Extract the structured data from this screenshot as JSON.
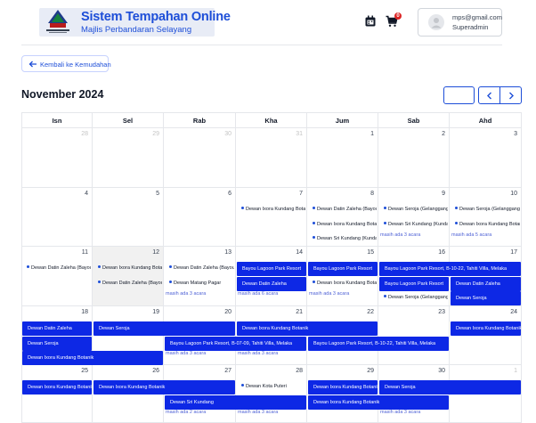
{
  "header": {
    "title": "Sistem Tempahan Online",
    "subtitle": "Majlis Perbandaran Selayang",
    "logo_caption": "Majlis Perbandaran Selayang",
    "cart_count": "0",
    "user_email": "mps@gmail.com",
    "user_role": "Superadmin"
  },
  "nav": {
    "back_label": "Kembali ke Kemudahan"
  },
  "calendar": {
    "month_label": "November 2024",
    "weekdays": [
      "Isn",
      "Sel",
      "Rab",
      "Kha",
      "Jum",
      "Sab",
      "Ahd"
    ],
    "weeks": [
      {
        "days": [
          "28",
          "29",
          "30",
          "31",
          "1",
          "2",
          "3"
        ],
        "other": [
          0,
          1,
          2,
          3
        ]
      },
      {
        "days": [
          "4",
          "5",
          "6",
          "7",
          "8",
          "9",
          "10"
        ],
        "other": []
      },
      {
        "days": [
          "11",
          "12",
          "13",
          "14",
          "15",
          "16",
          "17"
        ],
        "other": []
      },
      {
        "days": [
          "18",
          "19",
          "20",
          "21",
          "22",
          "23",
          "24"
        ],
        "other": []
      },
      {
        "days": [
          "25",
          "26",
          "27",
          "28",
          "29",
          "30",
          "1"
        ],
        "other": [
          6
        ]
      }
    ],
    "today": {
      "week": 2,
      "day": 1
    },
    "dot_events": [
      {
        "w": 1,
        "d": 3,
        "row": 0,
        "label": "Dewan Ixora Kundang Botanik"
      },
      {
        "w": 1,
        "d": 4,
        "row": 0,
        "label": "Dewan Datin Zaleha (Bayou Lagoon)"
      },
      {
        "w": 1,
        "d": 4,
        "row": 1,
        "label": "Dewan Ixora Kundang Botanik"
      },
      {
        "w": 1,
        "d": 4,
        "row": 2,
        "label": "Dewan Sri Kundang (Kundang)"
      },
      {
        "w": 1,
        "d": 5,
        "row": 0,
        "label": "Dewan Seroja (Gelanggang)"
      },
      {
        "w": 1,
        "d": 5,
        "row": 1,
        "label": "Dewan Sri Kundang (Kundang)"
      },
      {
        "w": 1,
        "d": 6,
        "row": 0,
        "label": "Dewan Seroja (Gelanggang)"
      },
      {
        "w": 1,
        "d": 6,
        "row": 1,
        "label": "Dewan Ixora Kundang Botanik"
      },
      {
        "w": 2,
        "d": 0,
        "row": 0,
        "label": "Dewan Datin Zaleha (Bayou Lagoon)"
      },
      {
        "w": 2,
        "d": 1,
        "row": 0,
        "label": "Dewan Ixora Kundang Botanik"
      },
      {
        "w": 2,
        "d": 1,
        "row": 1,
        "label": "Dewan Datin Zaleha (Bayou Lagoon)"
      },
      {
        "w": 2,
        "d": 2,
        "row": 0,
        "label": "Dewan Datin Zaleha (Bayou Lagoon)"
      },
      {
        "w": 2,
        "d": 2,
        "row": 1,
        "label": "Dewan Matang Pagar"
      },
      {
        "w": 2,
        "d": 4,
        "row": 1,
        "label": "Dewan Ixora Kundang Botanik"
      },
      {
        "w": 2,
        "d": 5,
        "row": 2,
        "label": "Dewan Seroja (Gelanggang)"
      },
      {
        "w": 4,
        "d": 3,
        "row": 0,
        "label": "Dewan Kota Puteri"
      }
    ],
    "bar_events": [
      {
        "w": 2,
        "d": 3,
        "span": 1,
        "row": 0,
        "label": "Bayou Lagoon Park Resort"
      },
      {
        "w": 2,
        "d": 4,
        "span": 1,
        "row": 0,
        "label": "Bayou Lagoon Park Resort"
      },
      {
        "w": 2,
        "d": 5,
        "span": 2,
        "row": 0,
        "label": "Bayou Lagoon Park Resort, B-10-22, Tahiti Villa, Melaka"
      },
      {
        "w": 2,
        "d": 3,
        "span": 1,
        "row": 1,
        "label": "Dewan Datin Zaleha"
      },
      {
        "w": 2,
        "d": 5,
        "span": 1,
        "row": 1,
        "label": "Bayou Lagoon Park Resort"
      },
      {
        "w": 2,
        "d": 6,
        "span": 1,
        "row": 1,
        "label": "Dewan Datin Zaleha"
      },
      {
        "w": 2,
        "d": 6,
        "span": 1,
        "row": 2,
        "label": "Dewan Seroja"
      },
      {
        "w": 3,
        "d": 0,
        "span": 1,
        "row": 0,
        "label": "Dewan Datin Zaleha"
      },
      {
        "w": 3,
        "d": 1,
        "span": 2,
        "row": 0,
        "label": "Dewan Seroja"
      },
      {
        "w": 3,
        "d": 3,
        "span": 2,
        "row": 0,
        "label": "Dewan Ixora Kundang Botanik"
      },
      {
        "w": 3,
        "d": 6,
        "span": 1,
        "row": 0,
        "label": "Dewan Ixora Kundang Botanik"
      },
      {
        "w": 3,
        "d": 0,
        "span": 1,
        "row": 1,
        "label": "Dewan Seroja"
      },
      {
        "w": 3,
        "d": 2,
        "span": 2,
        "row": 1,
        "label": "Bayou Lagoon Park Resort, B-07-09, Tahiti Villa, Melaka"
      },
      {
        "w": 3,
        "d": 4,
        "span": 2,
        "row": 1,
        "label": "Bayou Lagoon Park Resort, B-10-22, Tahiti Villa, Melaka"
      },
      {
        "w": 3,
        "d": 0,
        "span": 2,
        "row": 2,
        "label": "Dewan Ixora Kundang Botanik"
      },
      {
        "w": 4,
        "d": 0,
        "span": 1,
        "row": 0,
        "label": "Dewan Ixora Kundang Botanik"
      },
      {
        "w": 4,
        "d": 1,
        "span": 2,
        "row": 0,
        "label": "Dewan Ixora Kundang Botanik"
      },
      {
        "w": 4,
        "d": 4,
        "span": 1,
        "row": 0,
        "label": "Dewan Ixora Kundang Botanik"
      },
      {
        "w": 4,
        "d": 5,
        "span": 2,
        "row": 0,
        "label": "Dewan Seroja"
      },
      {
        "w": 4,
        "d": 2,
        "span": 2,
        "row": 1,
        "label": "Dewan Sri Kundang"
      },
      {
        "w": 4,
        "d": 4,
        "span": 2,
        "row": 1,
        "label": "Dewan Ixora Kundang Botanik"
      }
    ],
    "more_links": [
      {
        "w": 1,
        "d": 5,
        "row": 2,
        "label": "masih ada 3 acara"
      },
      {
        "w": 1,
        "d": 6,
        "row": 2,
        "label": "masih ada 5 acara"
      },
      {
        "w": 2,
        "d": 2,
        "row": 2,
        "label": "masih ada 3 acara"
      },
      {
        "w": 2,
        "d": 3,
        "row": 2,
        "label": "masih ada 6 acara"
      },
      {
        "w": 2,
        "d": 4,
        "row": 2,
        "label": "masih ada 3 acara"
      },
      {
        "w": 3,
        "d": 2,
        "row": 2,
        "label": "masih ada 3 acara"
      },
      {
        "w": 3,
        "d": 3,
        "row": 2,
        "label": "masih ada 3 acara"
      },
      {
        "w": 4,
        "d": 2,
        "row": 2,
        "label": "masih ada 2 acara"
      },
      {
        "w": 4,
        "d": 3,
        "row": 2,
        "label": "masih ada 3 acara"
      },
      {
        "w": 4,
        "d": 5,
        "row": 2,
        "label": "masih ada 3 acara"
      }
    ]
  },
  "colors": {
    "primary": "#1d4ed8",
    "event_bar": "#0d28e5",
    "badge": "#dc2626"
  }
}
